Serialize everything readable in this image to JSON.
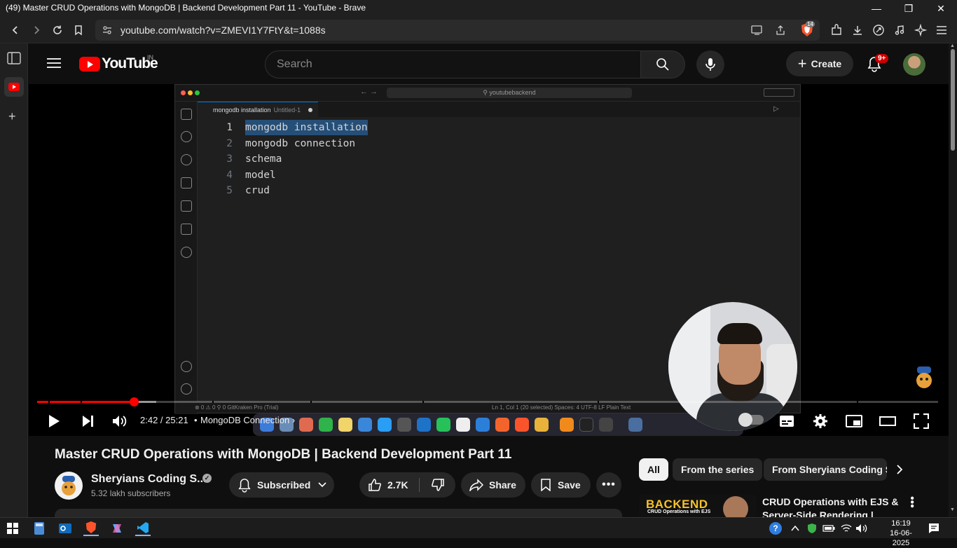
{
  "window": {
    "title": "(49) Master CRUD Operations with MongoDB | Backend Development Part 11 - YouTube - Brave",
    "minimize_icon": "minimize-icon",
    "restore_icon": "restore-icon",
    "close_icon": "close-icon"
  },
  "browser": {
    "url": "youtube.com/watch?v=ZMEVI1Y7FtY&t=1088s",
    "shield_count": "14"
  },
  "youtube_header": {
    "logo_text": "YouTube",
    "country": "IN",
    "search_placeholder": "Search",
    "create_label": "Create",
    "notification_count": "9+"
  },
  "vscode": {
    "search_text": "youtubebackend",
    "tab_name": "mongodb installation",
    "tab_sub": "Untitled-1",
    "lines": [
      {
        "num": "1",
        "text": "mongodb installation"
      },
      {
        "num": "2",
        "text": "mongodb connection"
      },
      {
        "num": "3",
        "text": "schema"
      },
      {
        "num": "4",
        "text": "model"
      },
      {
        "num": "5",
        "text": "crud"
      }
    ],
    "status_left": "⊗ 0 ⚠ 0   ⚲ 0  GitKraken Pro (Trial)",
    "status_right": "Ln 1, Col 1 (20 selected)   Spaces: 4   UTF-8   LF   Plain Text"
  },
  "player": {
    "current_time": "2:42",
    "duration": "25:21",
    "time_display": "2:42 / 25:21",
    "chapter": "MongoDB Connection",
    "progress_fraction": 0.107
  },
  "video": {
    "title": "Master CRUD Operations with MongoDB | Backend Development Part 11",
    "channel_name": "Sheryians Coding S...",
    "subscribers": "5.32 lakh subscribers",
    "subscribed_label": "Subscribed",
    "likes": "2.7K",
    "share_label": "Share",
    "save_label": "Save"
  },
  "chips": [
    "All",
    "From the series",
    "From Sheryians Coding S"
  ],
  "recommendation": {
    "thumb_text": "BACKEND",
    "thumb_sub": "CRUD Operations with EJS",
    "title": "CRUD Operations with EJS & Server-Side Rendering |"
  },
  "taskbar": {
    "time": "16:19",
    "date": "16-06-2025"
  },
  "colors": {
    "youtube_red": "#ff0000",
    "progress_red": "#ff0000",
    "selection_blue": "#264f78",
    "background": "#0f0f0f"
  }
}
